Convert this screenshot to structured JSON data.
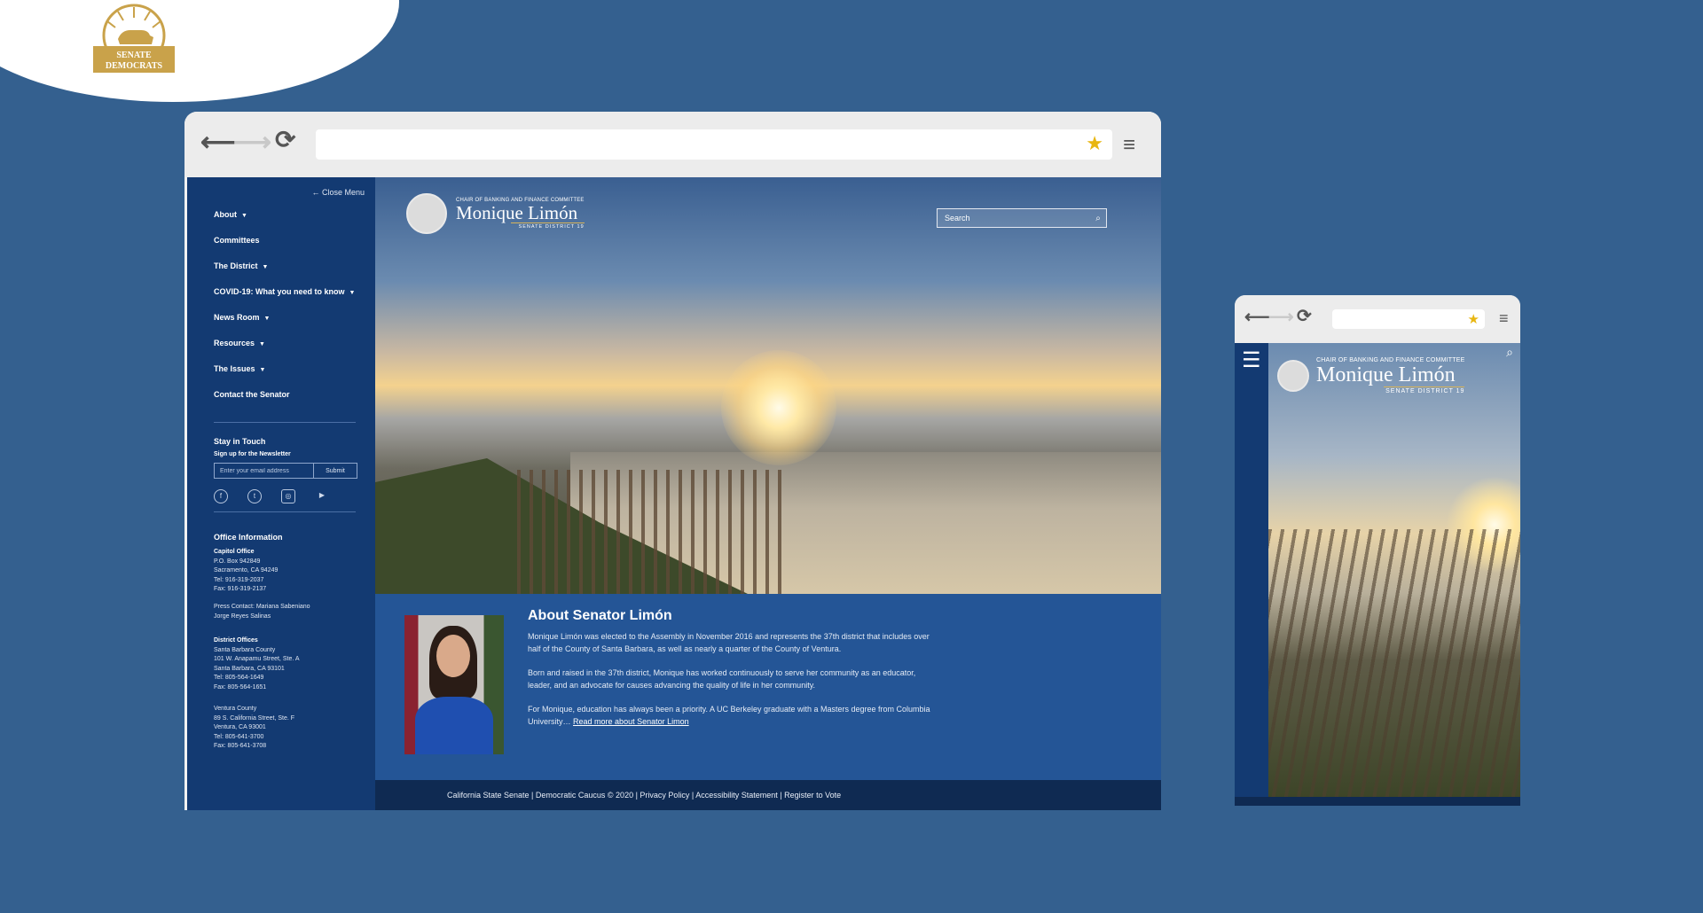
{
  "brand": {
    "line1": "SENATE",
    "line2": "DEMOCRATS"
  },
  "desktop": {
    "sidebar": {
      "close_label": "Close Menu",
      "menu": [
        {
          "label": "About",
          "caret": "▼"
        },
        {
          "label": "Committees",
          "caret": ""
        },
        {
          "label": "The District",
          "caret": "▼"
        },
        {
          "label": "COVID-19: What you need to know",
          "caret": "▼"
        },
        {
          "label": "News Room",
          "caret": "▼"
        },
        {
          "label": "Resources",
          "caret": "▼"
        },
        {
          "label": "The Issues",
          "caret": "▼"
        },
        {
          "label": "Contact the Senator",
          "caret": ""
        }
      ],
      "stay_title": "Stay in Touch",
      "newsletter_label": "Sign up for the Newsletter",
      "email_placeholder": "Enter your email address",
      "submit_label": "Submit",
      "office_title": "Office Information",
      "capitol": {
        "title": "Capitol Office",
        "lines": [
          "P.O. Box 942849",
          "Sacramento, CA 94249",
          "Tel: 916-319-2037",
          "Fax: 916-319-2137"
        ]
      },
      "press": [
        "Press Contact: Mariana Sabeniano",
        "Jorge Reyes Salinas"
      ],
      "district_title": "District Offices",
      "sb": [
        "Santa Barbara County",
        "101 W. Anapamu Street, Ste. A",
        "Santa Barbara, CA 93101",
        "Tel: 805-564-1649",
        "Fax: 805-564-1651"
      ],
      "ventura": [
        "Ventura County",
        "89 S. California Street, Ste. F",
        "Ventura, CA 93001",
        "Tel: 805-641-3700",
        "Fax: 805-641-3708"
      ]
    },
    "header": {
      "committee": "CHAIR OF BANKING AND FINANCE COMMITTEE",
      "name": "Monique  Limón",
      "district": "SENATE DISTRICT 19",
      "search_placeholder": "Search"
    },
    "about": {
      "title": "About Senator Limón",
      "p1": "Monique Limón was elected to the Assembly in November 2016 and represents the 37th district that includes over half of the County of Santa Barbara, as well as nearly a quarter of the County of Ventura.",
      "p2": "Born and raised in the 37th district, Monique has worked continuously to serve her community as an educator, leader, and an advocate for causes advancing the quality of life in her community.",
      "p3": "For Monique, education has always been a priority. A UC Berkeley graduate with a Masters degree from Columbia University…",
      "read_more": "Read more about Senator Limon"
    },
    "footer": "California State Senate  |  Democratic Caucus © 2020 |  Privacy Policy  |  Accessibility Statement  |  Register to Vote"
  },
  "mobile": {
    "committee": "CHAIR OF BANKING AND FINANCE COMMITTEE",
    "name": "Monique  Limón",
    "district": "SENATE DISTRICT 19"
  },
  "colors": {
    "background": "#34608f",
    "sidebar": "#133a72",
    "about": "#245596",
    "footer": "#0f2a52",
    "gold": "#c9a24a",
    "star": "#e8b611"
  }
}
